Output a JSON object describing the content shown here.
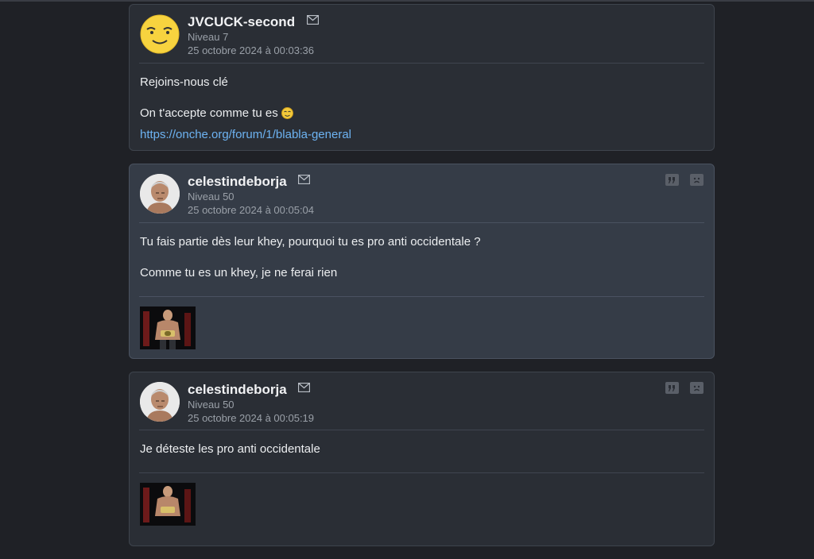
{
  "posts": [
    {
      "username": "JVCUCK-second",
      "level": "Niveau 7",
      "date": "25 octobre 2024 à 00:03:36",
      "lines": [
        "Rejoins-nous clé",
        "On t'accepte comme tu es"
      ],
      "link": "https://onche.org/forum/1/blabla-general",
      "avatar_icon": "smiley-avatar-icon"
    },
    {
      "username": "celestindeborja",
      "level": "Niveau 50",
      "date": "25 octobre 2024 à 00:05:04",
      "lines": [
        "Tu fais partie dès leur khey, pourquoi tu es pro anti occidentale ?",
        "Comme tu es un khey, je ne ferai rien"
      ],
      "avatar_icon": "fighter-avatar-icon"
    },
    {
      "username": "celestindeborja",
      "level": "Niveau 50",
      "date": "25 octobre 2024 à 00:05:19",
      "lines": [
        "Je déteste les pro anti occidentale"
      ],
      "avatar_icon": "fighter-avatar-icon"
    }
  ],
  "colors": {
    "background": "#1f2126",
    "card": "#2a2e35",
    "card_highlight": "#353c47",
    "link": "#6db3f2"
  }
}
